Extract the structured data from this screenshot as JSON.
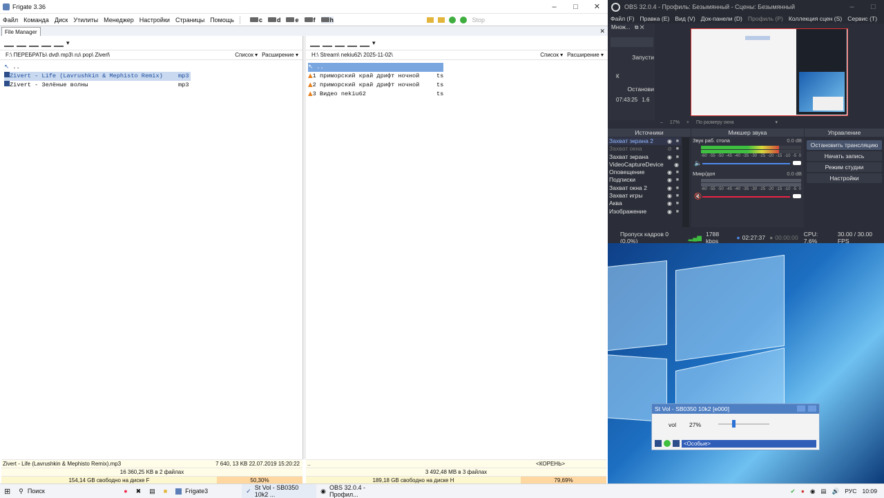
{
  "frigate": {
    "title": "Frigate 3.36",
    "menu": [
      "Файл",
      "Команда",
      "Диск",
      "Утилиты",
      "Менеджер",
      "Настройки",
      "Страницы",
      "Помощь"
    ],
    "drives": [
      "c",
      "d",
      "e",
      "f",
      "h"
    ],
    "stop_label": "Stop",
    "tab_label": "File Manager",
    "left": {
      "path": "F:\\ ПЕРЕБРАТЬ\\ dvd\\ mp3\\ ru\\ pop\\ Ziverl\\",
      "view": "Список",
      "ext": "Расширение",
      "files": [
        {
          "name": "..",
          "ext": "",
          "selected": false
        },
        {
          "name": "Zivert - Life (Lavrushkin & Mephisto Remix)",
          "ext": "mp3",
          "selected": true
        },
        {
          "name": "Zivert - Зелёные волны",
          "ext": "mp3",
          "selected": false
        }
      ],
      "status_file": "Zivert - Life (Lavrushkin & Mephisto Remix).mp3",
      "status_size": "7 640, 13 KB 22.07.2019 15:20:22",
      "status_total": "16 360,25 KB в 2 файлах",
      "status_free": "154,14 GB свободно на диске F",
      "status_pct": "50,30%"
    },
    "right": {
      "path": "H:\\ Stream\\ nekiu62\\ 2025-11-02\\",
      "view": "Список",
      "ext": "Расширение",
      "files": [
        {
          "name": "..",
          "ext": "",
          "selected": true
        },
        {
          "name": "1 приморский край дрифт ночной",
          "ext": "ts",
          "selected": false
        },
        {
          "name": "2 приморский край дрифт ночной",
          "ext": "ts",
          "selected": false
        },
        {
          "name": "3 Видео nekiu62",
          "ext": "ts",
          "selected": false
        }
      ],
      "status_file": "..",
      "status_size": "<КОРЕНЬ>",
      "status_total": "3 492,48 MB в 3 файлах",
      "status_free": "189,18 GB свободно на диске H",
      "status_pct": "79,69%"
    }
  },
  "obs": {
    "title": "OBS 32.0.4 - Профиль: Безымянный - Сцены: Безымянный",
    "menu": [
      "Файл (F)",
      "Правка (E)",
      "Вид (V)",
      "Док-панели (D)",
      "Профиль (P)",
      "Коллекция сцен (S)",
      "Сервис (T)"
    ],
    "left_dock": {
      "label": "Множ...",
      "btn1": "Запусти",
      "k": "К",
      "btn2": "Останови",
      "time": "07:43:25",
      "val": "1.6"
    },
    "zoom": "17%",
    "fit": "По размеру окна",
    "sources_header": "Источники",
    "mixer_header": "Микшер звука",
    "controls_header": "Управление",
    "sources": [
      {
        "name": "Захват экрана 2",
        "active": true,
        "visible": true
      },
      {
        "name": "Захват окна",
        "active": false,
        "visible": false
      },
      {
        "name": "Захват экрана",
        "active": false,
        "visible": true
      },
      {
        "name": "VideoCaptureDevice",
        "active": false,
        "visible": true
      },
      {
        "name": "Оповещение",
        "active": false,
        "visible": true
      },
      {
        "name": "Подписки",
        "active": false,
        "visible": true
      },
      {
        "name": "Захват окна 2",
        "active": false,
        "visible": true
      },
      {
        "name": "Захват игры",
        "active": false,
        "visible": true
      },
      {
        "name": "Аква",
        "active": false,
        "visible": true
      },
      {
        "name": "Изображение",
        "active": false,
        "visible": true
      }
    ],
    "mixer": [
      {
        "name": "Звук раб. стола",
        "db": "0.0 dB",
        "level": 0.78
      },
      {
        "name": "Микр/доп",
        "db": "0.0 dB",
        "level": 0.0
      }
    ],
    "scale": [
      "-60",
      "-55",
      "-50",
      "-45",
      "-40",
      "-35",
      "-30",
      "-25",
      "-20",
      "-15",
      "-10",
      "-5",
      "0"
    ],
    "controls": [
      "Остановить трансляцию",
      "Начать запись",
      "Режим студии",
      "Настройки"
    ],
    "status": {
      "dropped": "Пропуск кадров 0 (0.0%)",
      "kbps": "1788 kbps",
      "stream_time": "02:27:37",
      "rec_time": "00:00:00",
      "cpu": "CPU: 7.6%",
      "fps": "30.00 / 30.00 FPS"
    }
  },
  "volume": {
    "title": "St Vol - SB0350 10k2 [e000]",
    "label": "vol",
    "value": "27%",
    "level": 0.27,
    "device": "<Особые>"
  },
  "taskbar": {
    "search": "Поиск",
    "apps": [
      "Frigate3",
      "St Vol - SB0350 10k2 ...",
      "OBS 32.0.4 - Профил..."
    ],
    "lang": "РУС",
    "time": "10:09"
  }
}
